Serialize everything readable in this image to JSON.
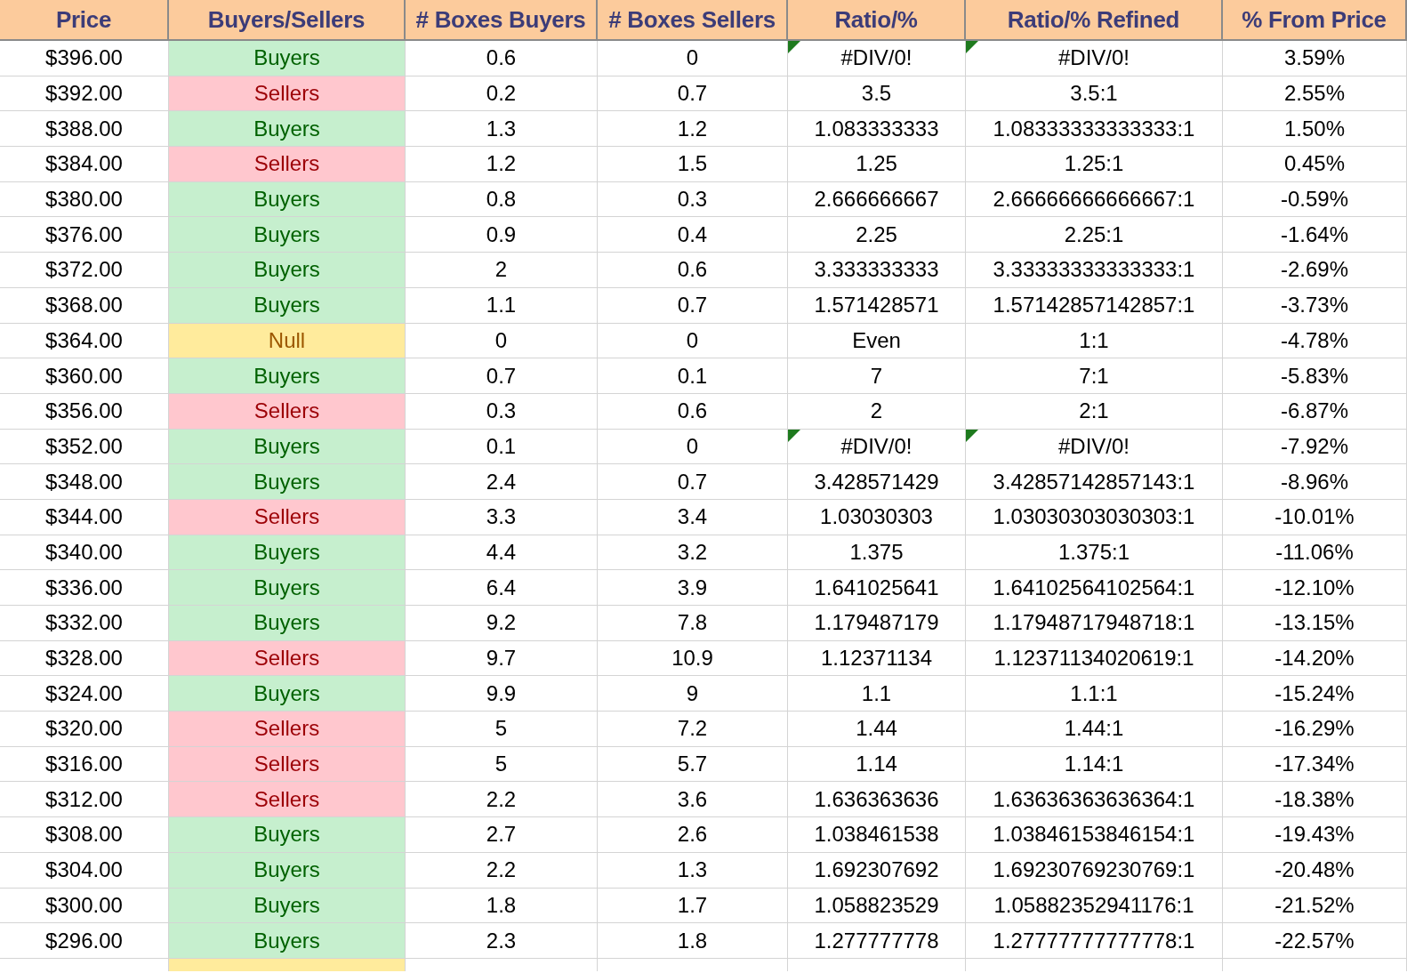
{
  "columns": [
    "Price",
    "Buyers/Sellers",
    "# Boxes Buyers",
    "# Boxes Sellers",
    "Ratio/%",
    "Ratio/% Refined",
    "% From Price"
  ],
  "rows": [
    {
      "price": "$396.00",
      "side": {
        "label": "Buyers",
        "kind": "buyers"
      },
      "boxes_buyers": "0.6",
      "boxes_sellers": "0",
      "ratio": {
        "text": "#DIV/0!",
        "error_flag": true
      },
      "refined": {
        "text": "#DIV/0!",
        "error_flag": true
      },
      "from_price": "3.59%"
    },
    {
      "price": "$392.00",
      "side": {
        "label": "Sellers",
        "kind": "sellers"
      },
      "boxes_buyers": "0.2",
      "boxes_sellers": "0.7",
      "ratio": {
        "text": "3.5",
        "error_flag": false
      },
      "refined": {
        "text": "3.5:1",
        "error_flag": false
      },
      "from_price": "2.55%"
    },
    {
      "price": "$388.00",
      "side": {
        "label": "Buyers",
        "kind": "buyers"
      },
      "boxes_buyers": "1.3",
      "boxes_sellers": "1.2",
      "ratio": {
        "text": "1.083333333",
        "error_flag": false
      },
      "refined": {
        "text": "1.08333333333333:1",
        "error_flag": false
      },
      "from_price": "1.50%"
    },
    {
      "price": "$384.00",
      "side": {
        "label": "Sellers",
        "kind": "sellers"
      },
      "boxes_buyers": "1.2",
      "boxes_sellers": "1.5",
      "ratio": {
        "text": "1.25",
        "error_flag": false
      },
      "refined": {
        "text": "1.25:1",
        "error_flag": false
      },
      "from_price": "0.45%"
    },
    {
      "price": "$380.00",
      "side": {
        "label": "Buyers",
        "kind": "buyers"
      },
      "boxes_buyers": "0.8",
      "boxes_sellers": "0.3",
      "ratio": {
        "text": "2.666666667",
        "error_flag": false
      },
      "refined": {
        "text": "2.66666666666667:1",
        "error_flag": false
      },
      "from_price": "-0.59%"
    },
    {
      "price": "$376.00",
      "side": {
        "label": "Buyers",
        "kind": "buyers"
      },
      "boxes_buyers": "0.9",
      "boxes_sellers": "0.4",
      "ratio": {
        "text": "2.25",
        "error_flag": false
      },
      "refined": {
        "text": "2.25:1",
        "error_flag": false
      },
      "from_price": "-1.64%"
    },
    {
      "price": "$372.00",
      "side": {
        "label": "Buyers",
        "kind": "buyers"
      },
      "boxes_buyers": "2",
      "boxes_sellers": "0.6",
      "ratio": {
        "text": "3.333333333",
        "error_flag": false
      },
      "refined": {
        "text": "3.33333333333333:1",
        "error_flag": false
      },
      "from_price": "-2.69%"
    },
    {
      "price": "$368.00",
      "side": {
        "label": "Buyers",
        "kind": "buyers"
      },
      "boxes_buyers": "1.1",
      "boxes_sellers": "0.7",
      "ratio": {
        "text": "1.571428571",
        "error_flag": false
      },
      "refined": {
        "text": "1.57142857142857:1",
        "error_flag": false
      },
      "from_price": "-3.73%"
    },
    {
      "price": "$364.00",
      "side": {
        "label": "Null",
        "kind": "null"
      },
      "boxes_buyers": "0",
      "boxes_sellers": "0",
      "ratio": {
        "text": "Even",
        "error_flag": false
      },
      "refined": {
        "text": "1:1",
        "error_flag": false
      },
      "from_price": "-4.78%"
    },
    {
      "price": "$360.00",
      "side": {
        "label": "Buyers",
        "kind": "buyers"
      },
      "boxes_buyers": "0.7",
      "boxes_sellers": "0.1",
      "ratio": {
        "text": "7",
        "error_flag": false
      },
      "refined": {
        "text": "7:1",
        "error_flag": false
      },
      "from_price": "-5.83%"
    },
    {
      "price": "$356.00",
      "side": {
        "label": "Sellers",
        "kind": "sellers"
      },
      "boxes_buyers": "0.3",
      "boxes_sellers": "0.6",
      "ratio": {
        "text": "2",
        "error_flag": false
      },
      "refined": {
        "text": "2:1",
        "error_flag": false
      },
      "from_price": "-6.87%"
    },
    {
      "price": "$352.00",
      "side": {
        "label": "Buyers",
        "kind": "buyers"
      },
      "boxes_buyers": "0.1",
      "boxes_sellers": "0",
      "ratio": {
        "text": "#DIV/0!",
        "error_flag": true
      },
      "refined": {
        "text": "#DIV/0!",
        "error_flag": true
      },
      "from_price": "-7.92%"
    },
    {
      "price": "$348.00",
      "side": {
        "label": "Buyers",
        "kind": "buyers"
      },
      "boxes_buyers": "2.4",
      "boxes_sellers": "0.7",
      "ratio": {
        "text": "3.428571429",
        "error_flag": false
      },
      "refined": {
        "text": "3.42857142857143:1",
        "error_flag": false
      },
      "from_price": "-8.96%"
    },
    {
      "price": "$344.00",
      "side": {
        "label": "Sellers",
        "kind": "sellers"
      },
      "boxes_buyers": "3.3",
      "boxes_sellers": "3.4",
      "ratio": {
        "text": "1.03030303",
        "error_flag": false
      },
      "refined": {
        "text": "1.03030303030303:1",
        "error_flag": false
      },
      "from_price": "-10.01%"
    },
    {
      "price": "$340.00",
      "side": {
        "label": "Buyers",
        "kind": "buyers"
      },
      "boxes_buyers": "4.4",
      "boxes_sellers": "3.2",
      "ratio": {
        "text": "1.375",
        "error_flag": false
      },
      "refined": {
        "text": "1.375:1",
        "error_flag": false
      },
      "from_price": "-11.06%"
    },
    {
      "price": "$336.00",
      "side": {
        "label": "Buyers",
        "kind": "buyers"
      },
      "boxes_buyers": "6.4",
      "boxes_sellers": "3.9",
      "ratio": {
        "text": "1.641025641",
        "error_flag": false
      },
      "refined": {
        "text": "1.64102564102564:1",
        "error_flag": false
      },
      "from_price": "-12.10%"
    },
    {
      "price": "$332.00",
      "side": {
        "label": "Buyers",
        "kind": "buyers"
      },
      "boxes_buyers": "9.2",
      "boxes_sellers": "7.8",
      "ratio": {
        "text": "1.179487179",
        "error_flag": false
      },
      "refined": {
        "text": "1.17948717948718:1",
        "error_flag": false
      },
      "from_price": "-13.15%"
    },
    {
      "price": "$328.00",
      "side": {
        "label": "Sellers",
        "kind": "sellers"
      },
      "boxes_buyers": "9.7",
      "boxes_sellers": "10.9",
      "ratio": {
        "text": "1.12371134",
        "error_flag": false
      },
      "refined": {
        "text": "1.12371134020619:1",
        "error_flag": false
      },
      "from_price": "-14.20%"
    },
    {
      "price": "$324.00",
      "side": {
        "label": "Buyers",
        "kind": "buyers"
      },
      "boxes_buyers": "9.9",
      "boxes_sellers": "9",
      "ratio": {
        "text": "1.1",
        "error_flag": false
      },
      "refined": {
        "text": "1.1:1",
        "error_flag": false
      },
      "from_price": "-15.24%"
    },
    {
      "price": "$320.00",
      "side": {
        "label": "Sellers",
        "kind": "sellers"
      },
      "boxes_buyers": "5",
      "boxes_sellers": "7.2",
      "ratio": {
        "text": "1.44",
        "error_flag": false
      },
      "refined": {
        "text": "1.44:1",
        "error_flag": false
      },
      "from_price": "-16.29%"
    },
    {
      "price": "$316.00",
      "side": {
        "label": "Sellers",
        "kind": "sellers"
      },
      "boxes_buyers": "5",
      "boxes_sellers": "5.7",
      "ratio": {
        "text": "1.14",
        "error_flag": false
      },
      "refined": {
        "text": "1.14:1",
        "error_flag": false
      },
      "from_price": "-17.34%"
    },
    {
      "price": "$312.00",
      "side": {
        "label": "Sellers",
        "kind": "sellers"
      },
      "boxes_buyers": "2.2",
      "boxes_sellers": "3.6",
      "ratio": {
        "text": "1.636363636",
        "error_flag": false
      },
      "refined": {
        "text": "1.63636363636364:1",
        "error_flag": false
      },
      "from_price": "-18.38%"
    },
    {
      "price": "$308.00",
      "side": {
        "label": "Buyers",
        "kind": "buyers"
      },
      "boxes_buyers": "2.7",
      "boxes_sellers": "2.6",
      "ratio": {
        "text": "1.038461538",
        "error_flag": false
      },
      "refined": {
        "text": "1.03846153846154:1",
        "error_flag": false
      },
      "from_price": "-19.43%"
    },
    {
      "price": "$304.00",
      "side": {
        "label": "Buyers",
        "kind": "buyers"
      },
      "boxes_buyers": "2.2",
      "boxes_sellers": "1.3",
      "ratio": {
        "text": "1.692307692",
        "error_flag": false
      },
      "refined": {
        "text": "1.69230769230769:1",
        "error_flag": false
      },
      "from_price": "-20.48%"
    },
    {
      "price": "$300.00",
      "side": {
        "label": "Buyers",
        "kind": "buyers"
      },
      "boxes_buyers": "1.8",
      "boxes_sellers": "1.7",
      "ratio": {
        "text": "1.058823529",
        "error_flag": false
      },
      "refined": {
        "text": "1.05882352941176:1",
        "error_flag": false
      },
      "from_price": "-21.52%"
    },
    {
      "price": "$296.00",
      "side": {
        "label": "Buyers",
        "kind": "buyers"
      },
      "boxes_buyers": "2.3",
      "boxes_sellers": "1.8",
      "ratio": {
        "text": "1.277777778",
        "error_flag": false
      },
      "refined": {
        "text": "1.27777777777778:1",
        "error_flag": false
      },
      "from_price": "-22.57%"
    }
  ],
  "partial_row": {
    "kind": "null"
  }
}
